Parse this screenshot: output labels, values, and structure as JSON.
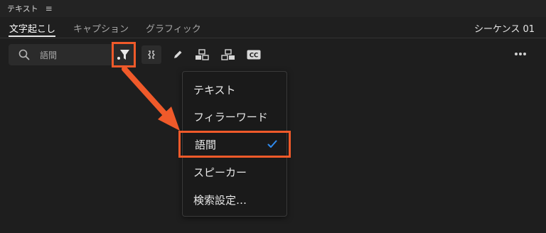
{
  "panel": {
    "title": "テキスト",
    "menu_icon": "hamburger-icon"
  },
  "tabs": [
    {
      "label": "文字起こし",
      "active": true
    },
    {
      "label": "キャプション",
      "active": false
    },
    {
      "label": "グラフィック",
      "active": false
    }
  ],
  "sequence_name": "シーケンス 01",
  "search": {
    "value": "語間",
    "icon": "search-icon"
  },
  "toolbar": {
    "filter_icon": "filter-icon",
    "icons": [
      "merge-icon",
      "pencil-icon",
      "split-left-icon",
      "split-right-icon",
      "closed-caption-icon"
    ],
    "cc_label": "CC",
    "more_icon": "more-icon"
  },
  "filter_menu": {
    "items": [
      {
        "label": "テキスト",
        "checked": false
      },
      {
        "label": "フィラーワード",
        "checked": false
      },
      {
        "label": "語間",
        "checked": true
      },
      {
        "label": "スピーカー",
        "checked": false
      },
      {
        "label": "検索設定…",
        "checked": false
      }
    ]
  },
  "colors": {
    "highlight": "#f05a2a",
    "check": "#2f8cf0",
    "background": "#1e1e1e"
  }
}
